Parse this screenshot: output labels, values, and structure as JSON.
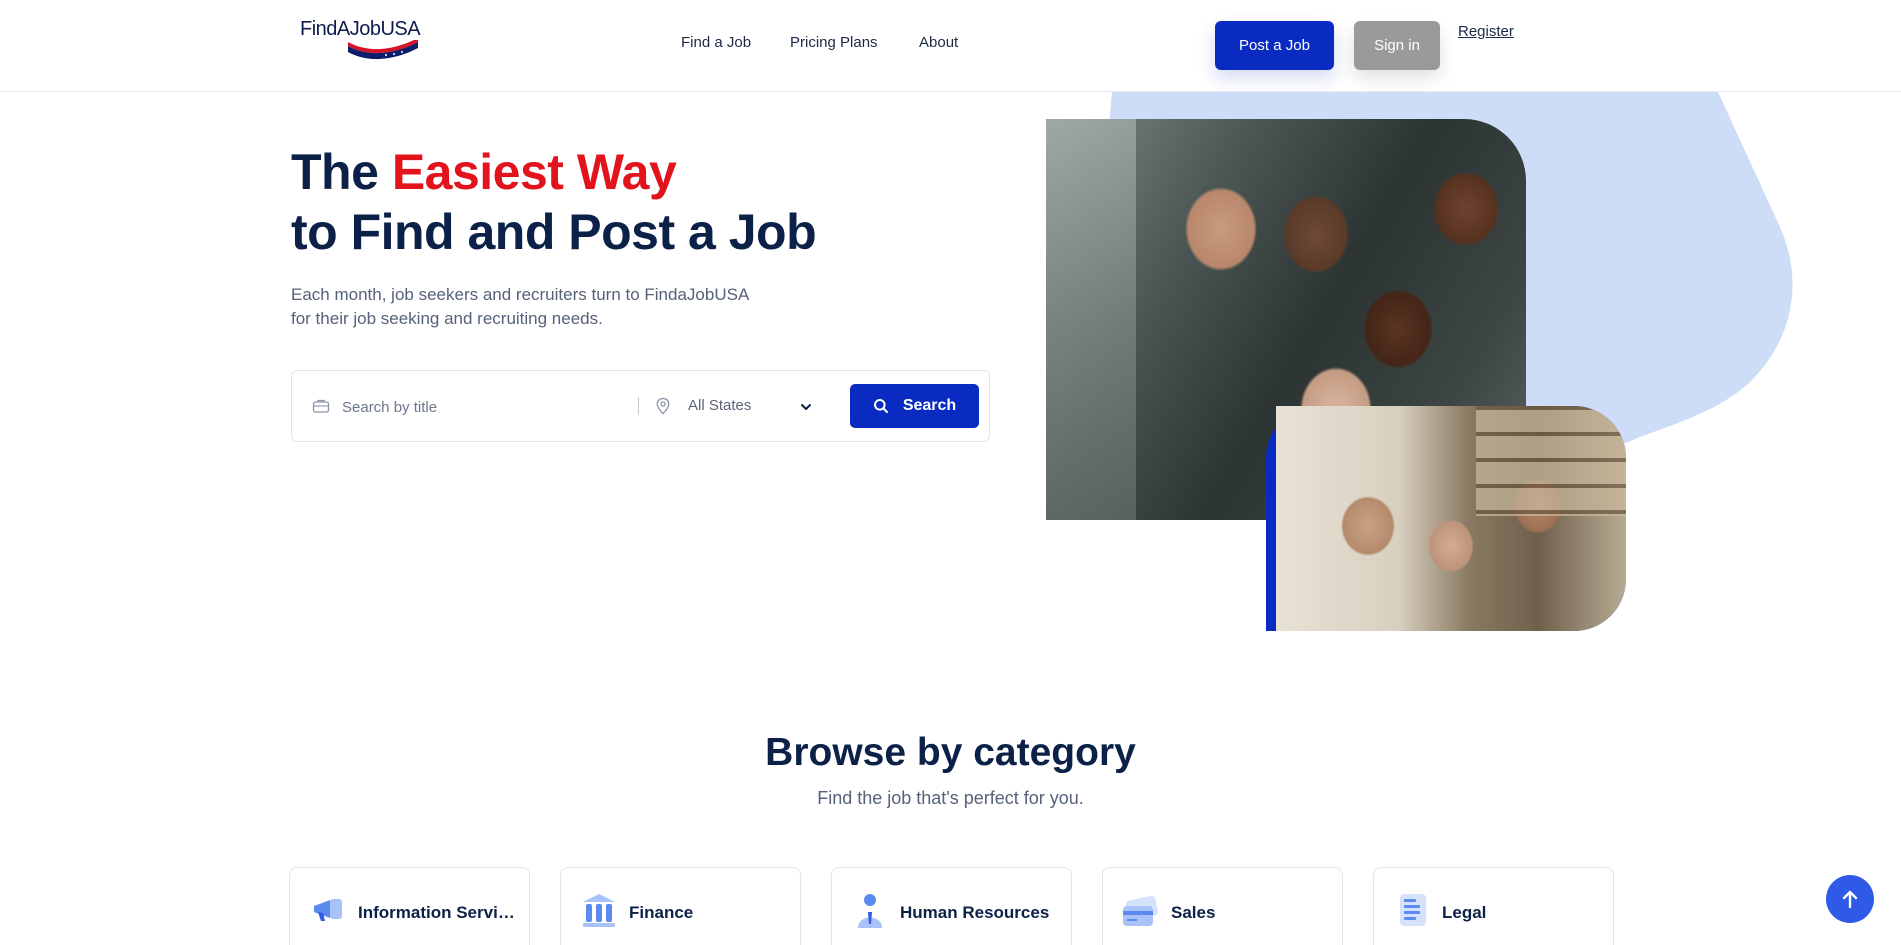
{
  "header": {
    "logo_text": "FindAJobUSA",
    "nav": [
      {
        "label": "Find a Job"
      },
      {
        "label": "Pricing Plans"
      },
      {
        "label": "About"
      }
    ],
    "post_job_label": "Post a Job",
    "signin_label": "Sign in",
    "register_label": "Register"
  },
  "hero": {
    "title_part1": "The",
    "title_accent": "Easiest Way",
    "title_line2": "to Find and Post a Job",
    "subtitle_line1": "Each month, job seekers and recruiters turn to FindaJobUSA",
    "subtitle_line2": "for their job seeking and recruiting needs."
  },
  "search": {
    "placeholder": "Search by title",
    "state_selected": "All States",
    "button_label": "Search"
  },
  "categories": {
    "title": "Browse by category",
    "subtitle": "Find the job that's perfect for you.",
    "items": [
      {
        "label": "Information Services",
        "icon": "megaphone-icon"
      },
      {
        "label": "Finance",
        "icon": "bank-icon"
      },
      {
        "label": "Human Resources",
        "icon": "person-icon"
      },
      {
        "label": "Sales",
        "icon": "credit-card-icon"
      },
      {
        "label": "Legal",
        "icon": "document-icon"
      }
    ]
  },
  "colors": {
    "primary": "#0a2bc2",
    "accent_red": "#e3131c",
    "heading": "#0b2147",
    "blob": "#cddcf7",
    "scroll_top": "#2f5ae8"
  }
}
